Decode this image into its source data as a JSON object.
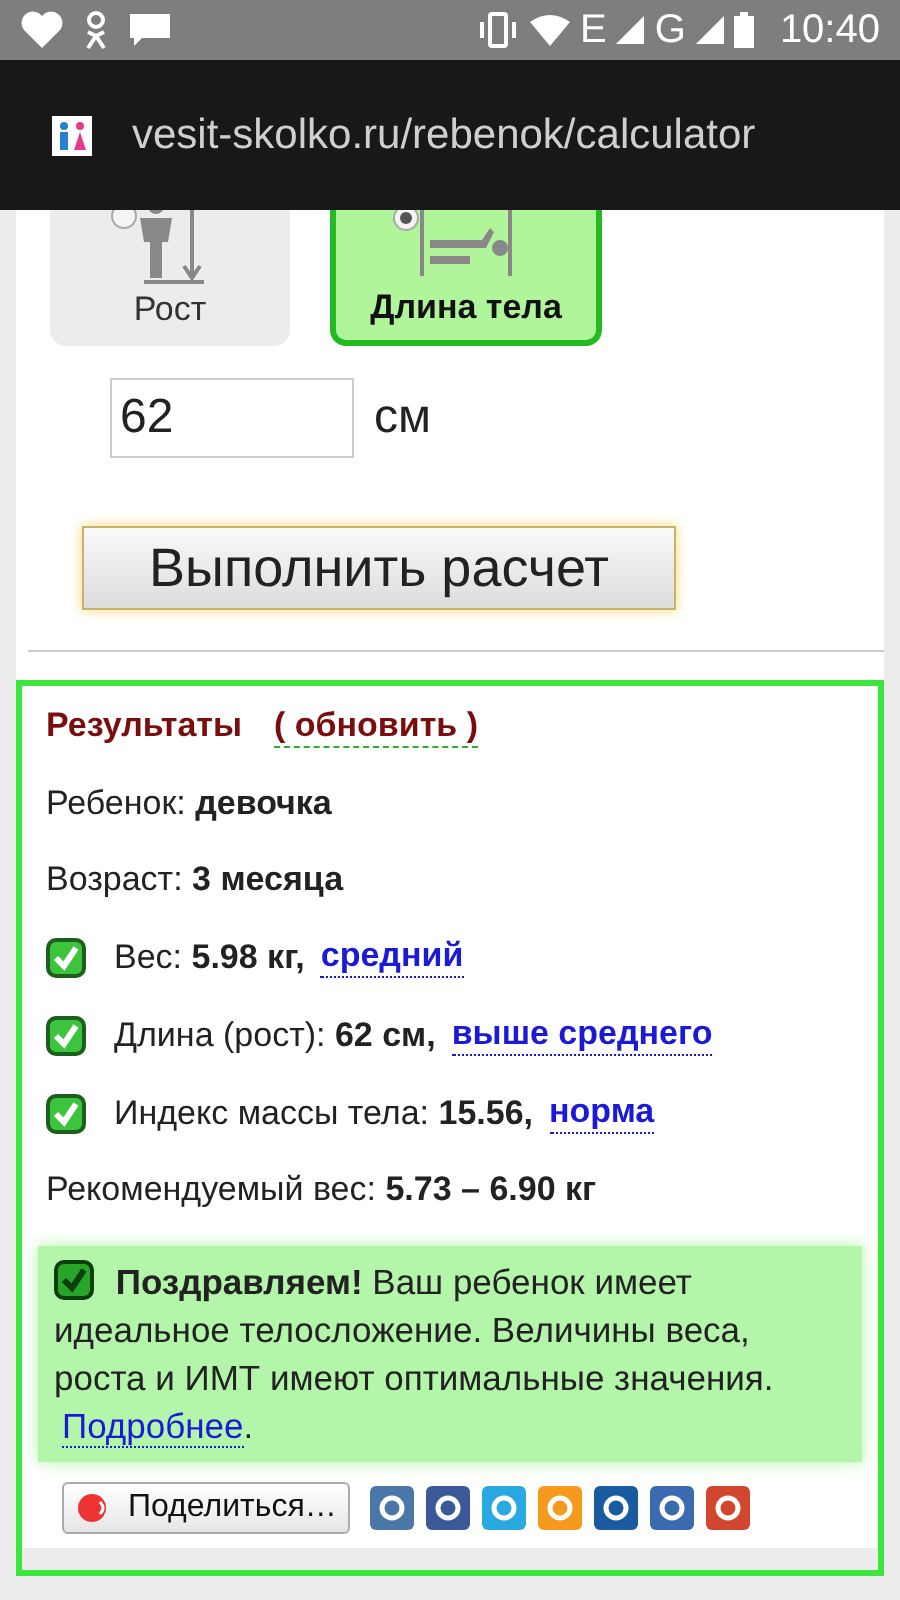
{
  "status_bar": {
    "network_1": "E",
    "network_2": "G",
    "time": "10:40"
  },
  "address_bar": {
    "url": "vesit-skolko.ru/rebenok/calculator"
  },
  "mode_buttons": [
    {
      "label": "Рост",
      "kind": "standing",
      "selected": false
    },
    {
      "label": "Длина тела",
      "kind": "lying",
      "selected": true
    }
  ],
  "length_field": {
    "value": "62",
    "unit": "см"
  },
  "calculate_button": "Выполнить расчет",
  "results": {
    "title": "Результаты",
    "refresh_link": "( обновить )",
    "rows": [
      {
        "kind": "plain",
        "text": "Ребенок: **девочка**"
      },
      {
        "kind": "plain",
        "text": "Возраст: **3 месяца**"
      },
      {
        "kind": "check",
        "checked": true,
        "text": "Вес: **5.98 кг,**",
        "link": "средний"
      },
      {
        "kind": "check",
        "checked": true,
        "text": "Длина (рост): **62 см,**",
        "link": "выше среднего"
      },
      {
        "kind": "check",
        "checked": true,
        "text": "Индекс массы тела: **15.56,**",
        "link": "норма"
      },
      {
        "kind": "plain",
        "text": "Рекомендуемый вес: **5.73 – 6.90 кг**"
      }
    ],
    "summary": {
      "checked": true,
      "text": "**Поздравляем!** Ваш ребенок имеет идеальное телосложение. Величины веса, роста и ИМТ имеют оптимальные значения.",
      "link": "Подробнее",
      "suffix": "."
    },
    "share_button": "Поделиться…"
  }
}
